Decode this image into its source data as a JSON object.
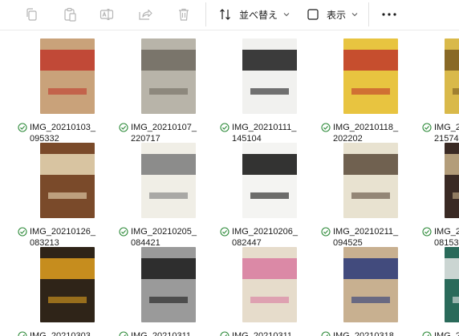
{
  "toolbar": {
    "copy_icon": "copy-icon",
    "paste_icon": "paste-icon",
    "rename_icon": "rename-icon",
    "share_icon": "share-icon",
    "delete_icon": "trash-icon",
    "sort_label": "並べ替え",
    "view_label": "表示",
    "more_icon": "more-icon"
  },
  "files": [
    {
      "name1": "IMG_20210103_",
      "name2": "095332",
      "cover": "#c9a27a",
      "accent": "#c0392b"
    },
    {
      "name1": "IMG_20210107_",
      "name2": "220717",
      "cover": "#b8b4a9",
      "accent": "#6f6a60"
    },
    {
      "name1": "IMG_20210111_",
      "name2": "145104",
      "cover": "#f1f1ef",
      "accent": "#1b1b1b"
    },
    {
      "name1": "IMG_20210118_",
      "name2": "202202",
      "cover": "#e8c440",
      "accent": "#c0392b"
    },
    {
      "name1": "IMG_2",
      "name2": "21574",
      "cover": "#d9b94a",
      "accent": "#7a5a20"
    },
    {
      "name1": "IMG_20210126_",
      "name2": "083213",
      "cover": "#7a4a2a",
      "accent": "#e9d9b6"
    },
    {
      "name1": "IMG_20210205_",
      "name2": "084421",
      "cover": "#f0eee6",
      "accent": "#7a7a7a"
    },
    {
      "name1": "IMG_20210206_",
      "name2": "082447",
      "cover": "#f4f4f2",
      "accent": "#111111"
    },
    {
      "name1": "IMG_20210211_",
      "name2": "094525",
      "cover": "#e8e2d0",
      "accent": "#5a4a3a"
    },
    {
      "name1": "IMG_2",
      "name2": "08153",
      "cover": "#3a2a24",
      "accent": "#c9b28a"
    },
    {
      "name1": "IMG_20210303",
      "name2": "",
      "cover": "#2f2418",
      "accent": "#e0a020"
    },
    {
      "name1": "IMG_20210311",
      "name2": "",
      "cover": "#9a9a9a",
      "accent": "#1b1b1b"
    },
    {
      "name1": "IMG_20210311",
      "name2": "",
      "cover": "#e6dccb",
      "accent": "#d87aa0"
    },
    {
      "name1": "IMG_20210318",
      "name2": "",
      "cover": "#c8b090",
      "accent": "#2a3a7a"
    },
    {
      "name1": "IMG_2",
      "name2": "",
      "cover": "#2a6a5a",
      "accent": "#e8e8e8"
    }
  ]
}
